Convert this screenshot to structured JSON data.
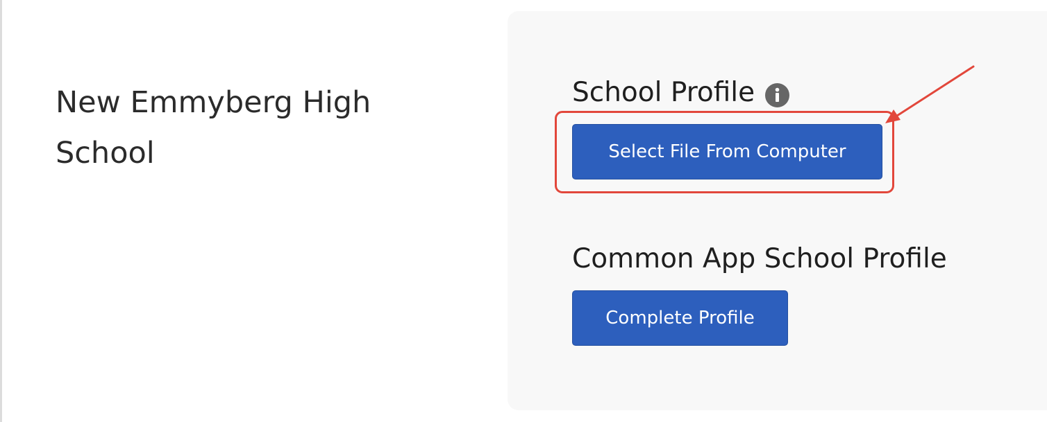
{
  "school": {
    "name": "New Emmyberg High School"
  },
  "school_profile": {
    "heading": "School Profile",
    "info_icon": "info-circle-icon",
    "button_label": "Select File From Computer"
  },
  "common_app_profile": {
    "heading": "Common App School Profile",
    "button_label": "Complete Profile"
  },
  "annotation": {
    "color": "#e2473b",
    "target": "Select File From Computer"
  },
  "colors": {
    "button": "#2d5fbd",
    "panel": "#f8f8f8",
    "text": "#2b2b2b"
  }
}
